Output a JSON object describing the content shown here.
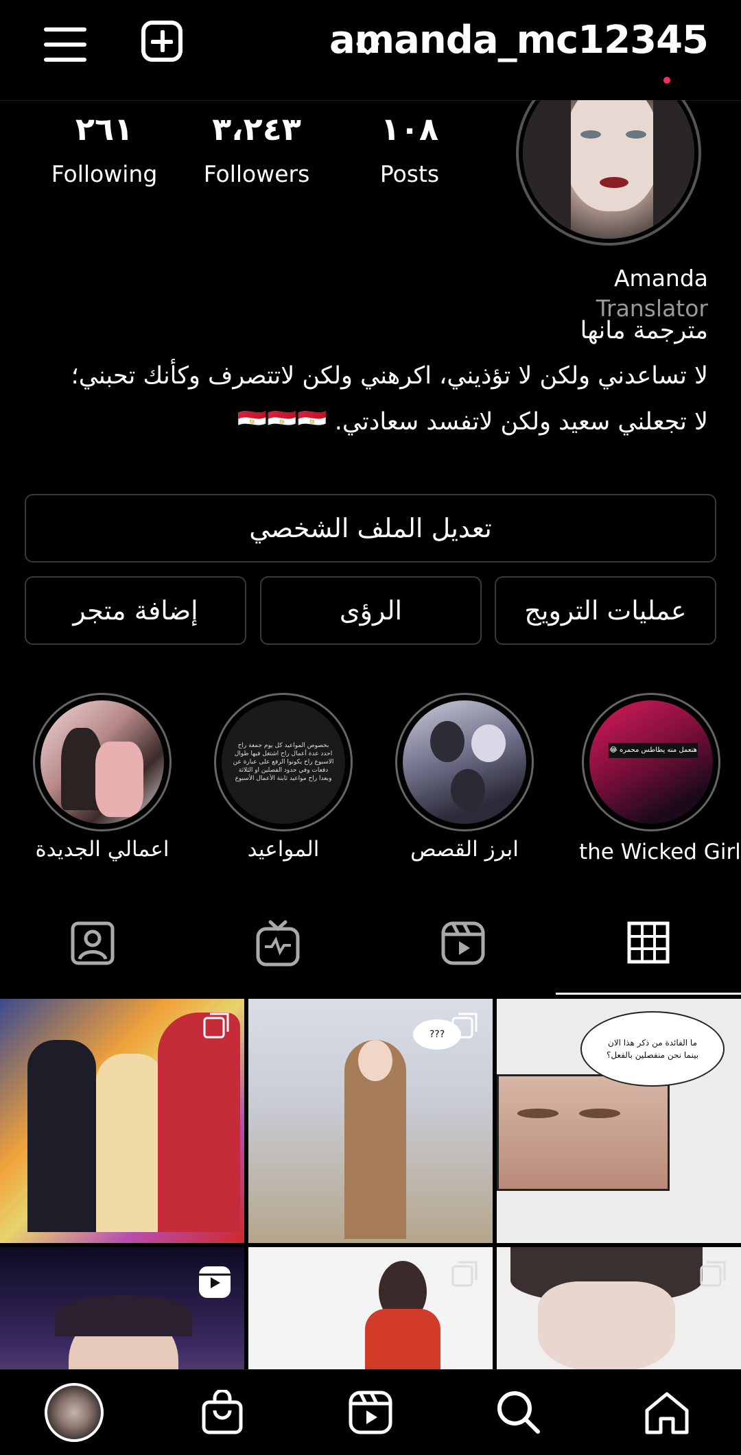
{
  "header": {
    "username": "amanda_mc12345",
    "icons": [
      "menu-icon",
      "create-plus-icon",
      "chevron-down-icon"
    ]
  },
  "stats": {
    "following": {
      "value": "٢٦١",
      "label": "Following"
    },
    "followers": {
      "value": "٣،٢٤٣",
      "label": "Followers"
    },
    "posts": {
      "value": "١٠٨",
      "label": "Posts"
    }
  },
  "profile": {
    "name": "Amanda",
    "category": "Translator",
    "bio_lines": [
      "مترجمة مانها",
      "لا تساعدني ولكن لا تؤذيني، اكرهني ولكن لاتتصرف وكأنك تحبني؛",
      "لا تجعلني سعيد ولكن لاتفسد سعادتي. 🇪🇬🇪🇬🇪🇬"
    ]
  },
  "buttons": {
    "edit_profile": "تعديل الملف الشخصي",
    "promotions": "عمليات الترويج",
    "insights": "الرؤى",
    "add_shop": "إضافة متجر"
  },
  "highlights": [
    {
      "label": "اعمالي الجديدة"
    },
    {
      "label": "المواعيد"
    },
    {
      "label": "ابرز القصص"
    },
    {
      "label": "the Wicked Girl"
    }
  ],
  "highlight_texts": {
    "wicked_caption": "هنعمل منه يطاطس محمره 😂",
    "schedule_text": "بخصوص المواعيد كل يوم جمعة راح احدد عدة أعمال راح اشتغل فيها طوال الاسبوع راح يكونوا الرفع على عبارة عن دفعات وفي حدود الفصلين او الثلاثة وبعدا راح مواعيد ثابتة الأعمال الأسبوع"
  },
  "tabs": [
    {
      "name": "grid-icon",
      "active": true
    },
    {
      "name": "reels-icon",
      "active": false
    },
    {
      "name": "igtv-icon",
      "active": false
    },
    {
      "name": "tagged-icon",
      "active": false
    }
  ],
  "grid_texts": {
    "bubble_1": "ما الفائدة من ذكر هذا الان",
    "bubble_2": "بينما نحن منفصلين بالفعل؟",
    "question": "???"
  },
  "bottom_nav": [
    "home-icon",
    "search-icon",
    "reels-icon",
    "shop-icon",
    "profile-avatar"
  ],
  "colors": {
    "background": "#000000",
    "text": "#ffffff",
    "muted": "#9a9a9a",
    "border": "#3a3a3a",
    "notification": "#ff2d55"
  }
}
